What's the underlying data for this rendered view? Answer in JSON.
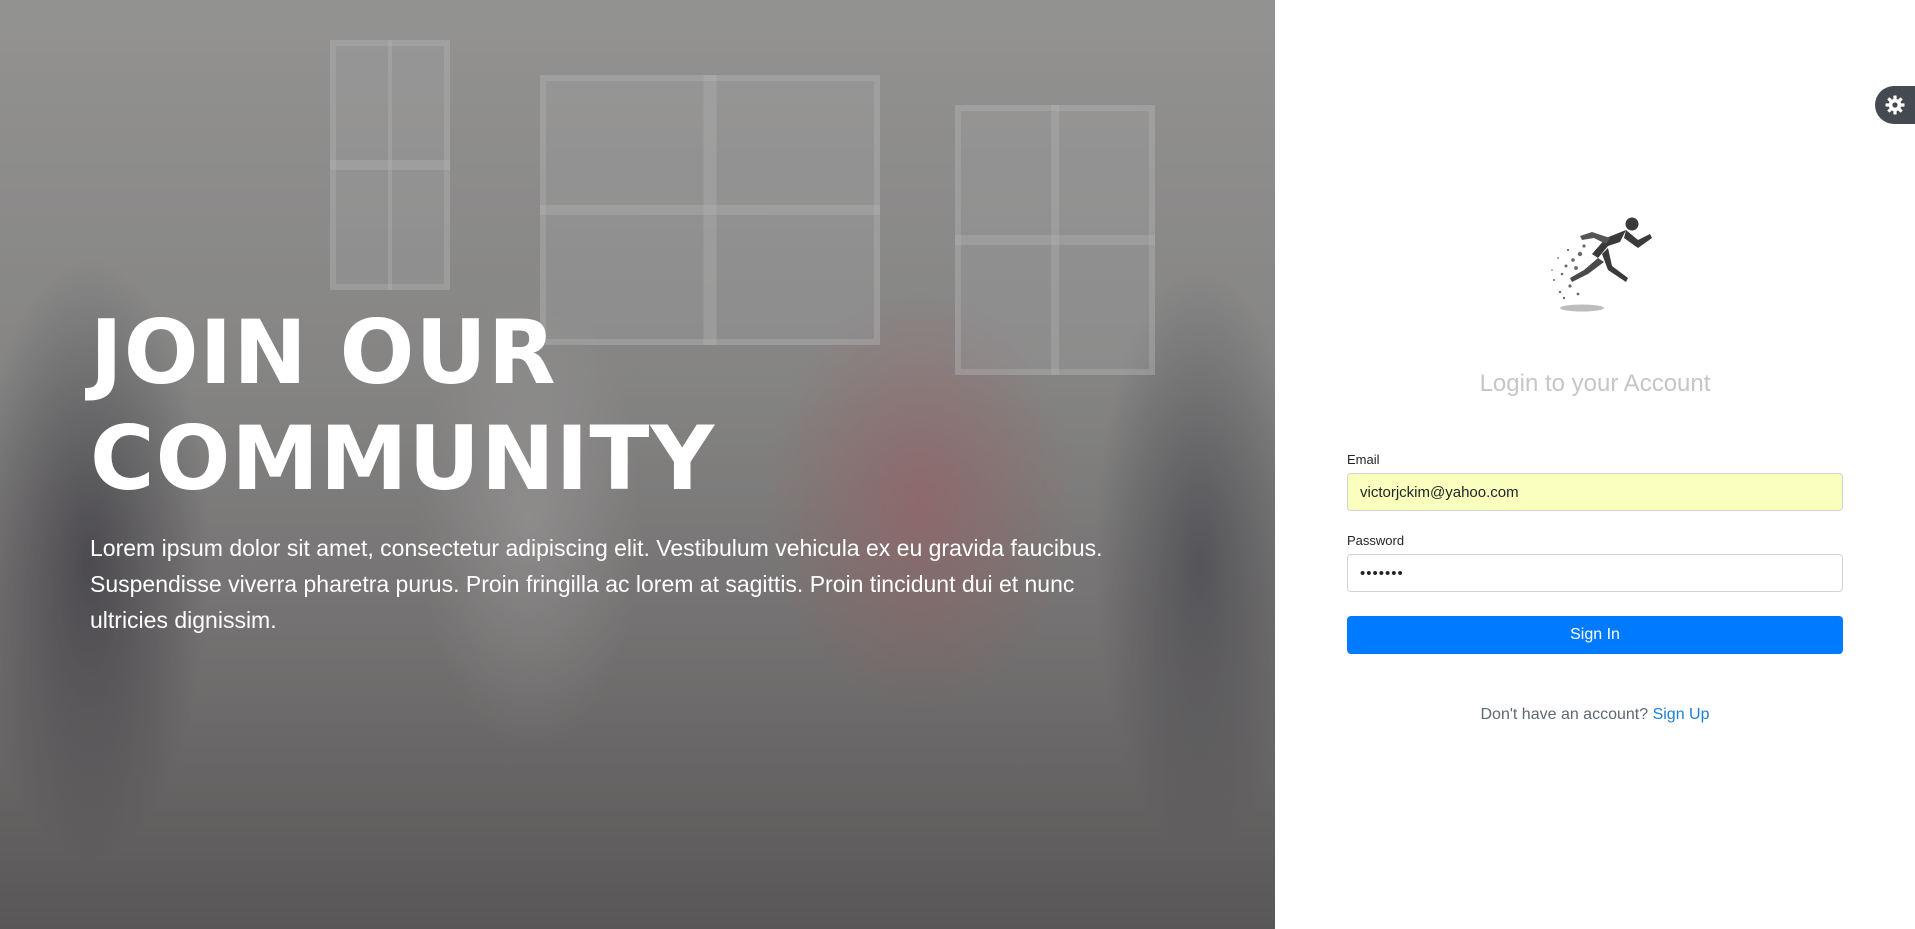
{
  "hero": {
    "title_line1": "JOIN OUR",
    "title_line2": "COMMUNITY",
    "description": "Lorem ipsum dolor sit amet, consectetur adipiscing elit. Vestibulum vehicula ex eu gravida faucibus. Suspendisse viverra pharetra purus. Proin fringilla ac lorem at sagittis. Proin tincidunt dui et nunc ultricies dignissim."
  },
  "panel": {
    "settings_icon": "gear-icon",
    "logo_icon": "running-man-logo",
    "title": "Login to your Account",
    "email": {
      "label": "Email",
      "value": "victorjckim@yahoo.com"
    },
    "password": {
      "label": "Password",
      "value": "•••••••"
    },
    "signin_label": "Sign In",
    "signup_prompt": "Don't have an account?",
    "signup_link": "Sign Up"
  },
  "colors": {
    "primary": "#007bff",
    "autofill": "#faffbd",
    "title_muted": "#c3c6cb",
    "link": "#1a7fd6"
  }
}
